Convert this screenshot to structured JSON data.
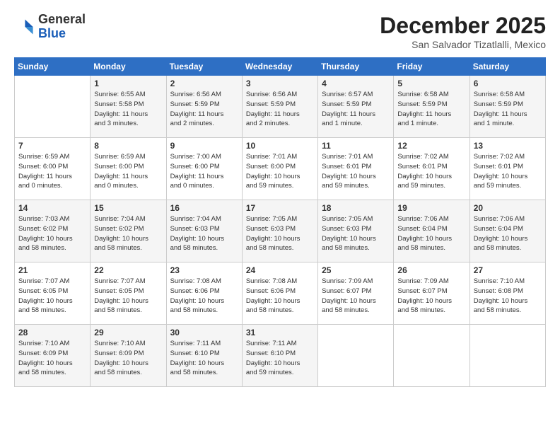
{
  "header": {
    "logo_line1": "General",
    "logo_line2": "Blue",
    "month": "December 2025",
    "location": "San Salvador Tizatlalli, Mexico"
  },
  "weekdays": [
    "Sunday",
    "Monday",
    "Tuesday",
    "Wednesday",
    "Thursday",
    "Friday",
    "Saturday"
  ],
  "weeks": [
    [
      {
        "day": "",
        "info": ""
      },
      {
        "day": "1",
        "info": "Sunrise: 6:55 AM\nSunset: 5:58 PM\nDaylight: 11 hours\nand 3 minutes."
      },
      {
        "day": "2",
        "info": "Sunrise: 6:56 AM\nSunset: 5:59 PM\nDaylight: 11 hours\nand 2 minutes."
      },
      {
        "day": "3",
        "info": "Sunrise: 6:56 AM\nSunset: 5:59 PM\nDaylight: 11 hours\nand 2 minutes."
      },
      {
        "day": "4",
        "info": "Sunrise: 6:57 AM\nSunset: 5:59 PM\nDaylight: 11 hours\nand 1 minute."
      },
      {
        "day": "5",
        "info": "Sunrise: 6:58 AM\nSunset: 5:59 PM\nDaylight: 11 hours\nand 1 minute."
      },
      {
        "day": "6",
        "info": "Sunrise: 6:58 AM\nSunset: 5:59 PM\nDaylight: 11 hours\nand 1 minute."
      }
    ],
    [
      {
        "day": "7",
        "info": "Sunrise: 6:59 AM\nSunset: 6:00 PM\nDaylight: 11 hours\nand 0 minutes."
      },
      {
        "day": "8",
        "info": "Sunrise: 6:59 AM\nSunset: 6:00 PM\nDaylight: 11 hours\nand 0 minutes."
      },
      {
        "day": "9",
        "info": "Sunrise: 7:00 AM\nSunset: 6:00 PM\nDaylight: 11 hours\nand 0 minutes."
      },
      {
        "day": "10",
        "info": "Sunrise: 7:01 AM\nSunset: 6:00 PM\nDaylight: 10 hours\nand 59 minutes."
      },
      {
        "day": "11",
        "info": "Sunrise: 7:01 AM\nSunset: 6:01 PM\nDaylight: 10 hours\nand 59 minutes."
      },
      {
        "day": "12",
        "info": "Sunrise: 7:02 AM\nSunset: 6:01 PM\nDaylight: 10 hours\nand 59 minutes."
      },
      {
        "day": "13",
        "info": "Sunrise: 7:02 AM\nSunset: 6:01 PM\nDaylight: 10 hours\nand 59 minutes."
      }
    ],
    [
      {
        "day": "14",
        "info": "Sunrise: 7:03 AM\nSunset: 6:02 PM\nDaylight: 10 hours\nand 58 minutes."
      },
      {
        "day": "15",
        "info": "Sunrise: 7:04 AM\nSunset: 6:02 PM\nDaylight: 10 hours\nand 58 minutes."
      },
      {
        "day": "16",
        "info": "Sunrise: 7:04 AM\nSunset: 6:03 PM\nDaylight: 10 hours\nand 58 minutes."
      },
      {
        "day": "17",
        "info": "Sunrise: 7:05 AM\nSunset: 6:03 PM\nDaylight: 10 hours\nand 58 minutes."
      },
      {
        "day": "18",
        "info": "Sunrise: 7:05 AM\nSunset: 6:03 PM\nDaylight: 10 hours\nand 58 minutes."
      },
      {
        "day": "19",
        "info": "Sunrise: 7:06 AM\nSunset: 6:04 PM\nDaylight: 10 hours\nand 58 minutes."
      },
      {
        "day": "20",
        "info": "Sunrise: 7:06 AM\nSunset: 6:04 PM\nDaylight: 10 hours\nand 58 minutes."
      }
    ],
    [
      {
        "day": "21",
        "info": "Sunrise: 7:07 AM\nSunset: 6:05 PM\nDaylight: 10 hours\nand 58 minutes."
      },
      {
        "day": "22",
        "info": "Sunrise: 7:07 AM\nSunset: 6:05 PM\nDaylight: 10 hours\nand 58 minutes."
      },
      {
        "day": "23",
        "info": "Sunrise: 7:08 AM\nSunset: 6:06 PM\nDaylight: 10 hours\nand 58 minutes."
      },
      {
        "day": "24",
        "info": "Sunrise: 7:08 AM\nSunset: 6:06 PM\nDaylight: 10 hours\nand 58 minutes."
      },
      {
        "day": "25",
        "info": "Sunrise: 7:09 AM\nSunset: 6:07 PM\nDaylight: 10 hours\nand 58 minutes."
      },
      {
        "day": "26",
        "info": "Sunrise: 7:09 AM\nSunset: 6:07 PM\nDaylight: 10 hours\nand 58 minutes."
      },
      {
        "day": "27",
        "info": "Sunrise: 7:10 AM\nSunset: 6:08 PM\nDaylight: 10 hours\nand 58 minutes."
      }
    ],
    [
      {
        "day": "28",
        "info": "Sunrise: 7:10 AM\nSunset: 6:09 PM\nDaylight: 10 hours\nand 58 minutes."
      },
      {
        "day": "29",
        "info": "Sunrise: 7:10 AM\nSunset: 6:09 PM\nDaylight: 10 hours\nand 58 minutes."
      },
      {
        "day": "30",
        "info": "Sunrise: 7:11 AM\nSunset: 6:10 PM\nDaylight: 10 hours\nand 58 minutes."
      },
      {
        "day": "31",
        "info": "Sunrise: 7:11 AM\nSunset: 6:10 PM\nDaylight: 10 hours\nand 59 minutes."
      },
      {
        "day": "",
        "info": ""
      },
      {
        "day": "",
        "info": ""
      },
      {
        "day": "",
        "info": ""
      }
    ]
  ]
}
